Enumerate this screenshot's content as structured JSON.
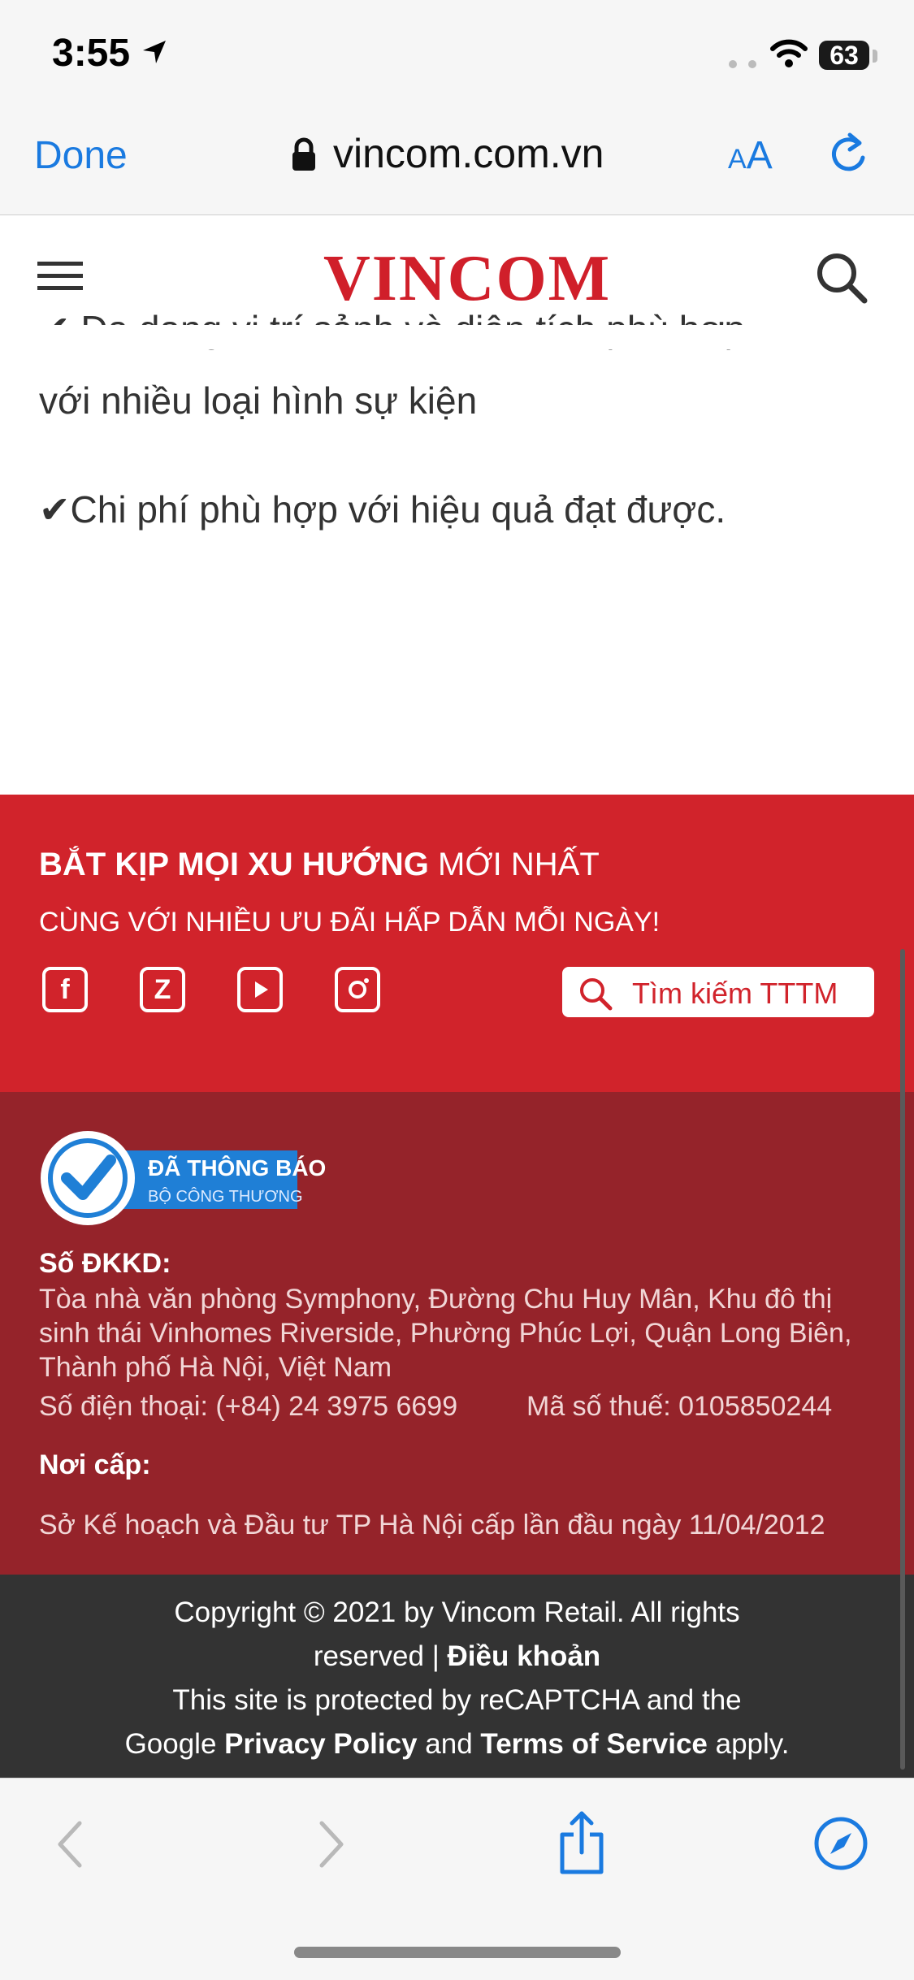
{
  "status": {
    "time": "3:55",
    "battery": "63"
  },
  "browser": {
    "done_label": "Done",
    "url": "vincom.com.vn",
    "text_size_label": "AA"
  },
  "site": {
    "logo": "VINCOM"
  },
  "content": {
    "partial_line": "✔ Đa dạng vị trí sảnh và diện tích phù hợp",
    "line2": "với nhiều loại hình sự kiện",
    "line3": "✔Chi phí phù hợp với hiệu quả đạt được."
  },
  "promo": {
    "headline_bold": "BẮT KỊP MỌI XU HƯỚNG",
    "headline_rest": " MỚI NHẤT",
    "subline": "CÙNG VỚI NHIỀU ƯU ĐÃI HẤP DẪN MỖI NGÀY!",
    "social": {
      "facebook": "f",
      "zalo": "Z"
    },
    "search_label": "Tìm kiếm TTTM"
  },
  "info": {
    "badge_line1": "ĐÃ THÔNG BÁO",
    "badge_line2": "BỘ CÔNG THƯƠNG",
    "dkkd_label": "Số ĐKKD:",
    "address": "Tòa nhà văn phòng Symphony, Đường Chu Huy Mân, Khu đô thị sinh thái Vinhomes Riverside, Phường Phúc Lợi, Quận Long Biên, Thành phố Hà Nội, Việt Nam",
    "phone": "Số điện thoại: (+84) 24 3975 6699",
    "tax": "Mã số thuế: 0105850244",
    "noicap_label": "Nơi cấp:",
    "noicap": "Sở Kế hoạch và Đầu tư TP Hà Nội cấp lần đầu ngày 11/04/2012"
  },
  "copyright": {
    "line1": "Copyright © 2021 by Vincom Retail. All rights",
    "line2_pre": "reserved | ",
    "terms": "Điều khoản",
    "line3": "This site is protected by reCAPTCHA and the",
    "line4_pre": "Google ",
    "privacy": "Privacy Policy",
    "and": " and ",
    "tos": "Terms of Service",
    "apply": " apply."
  }
}
